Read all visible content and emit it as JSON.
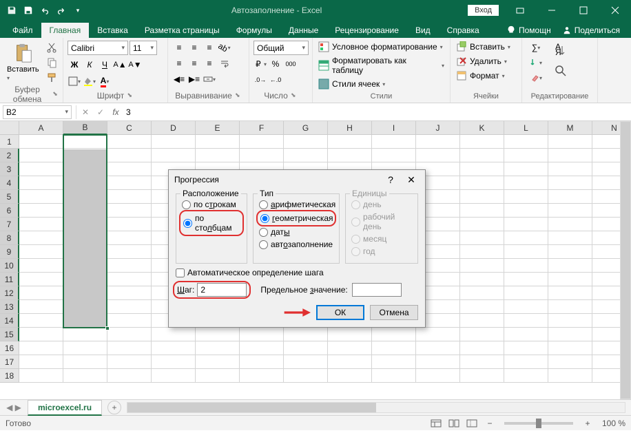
{
  "titlebar": {
    "title": "Автозаполнение  -  Excel",
    "login": "Вход"
  },
  "tabs": {
    "file": "Файл",
    "home": "Главная",
    "insert": "Вставка",
    "layout": "Разметка страницы",
    "formulas": "Формулы",
    "data": "Данные",
    "review": "Рецензирование",
    "view": "Вид",
    "help": "Справка",
    "assist": "Помощн",
    "share": "Поделиться"
  },
  "ribbon": {
    "clipboard": {
      "paste": "Вставить",
      "label": "Буфер обмена"
    },
    "font": {
      "family": "Calibri",
      "size": "11",
      "label": "Шрифт"
    },
    "align": {
      "label": "Выравнивание"
    },
    "number": {
      "format": "Общий",
      "label": "Число"
    },
    "styles": {
      "cond": "Условное форматирование",
      "table": "Форматировать как таблицу",
      "cell": "Стили ячеек",
      "label": "Стили"
    },
    "cells": {
      "insert": "Вставить",
      "delete": "Удалить",
      "format": "Формат",
      "label": "Ячейки"
    },
    "editing": {
      "label": "Редактирование"
    }
  },
  "namebox": "B2",
  "formula": "3",
  "columns": [
    "A",
    "B",
    "C",
    "D",
    "E",
    "F",
    "G",
    "H",
    "I",
    "J",
    "K",
    "L",
    "M",
    "N"
  ],
  "rows": [
    "1",
    "2",
    "3",
    "4",
    "5",
    "6",
    "7",
    "8",
    "9",
    "10",
    "11",
    "12",
    "13",
    "14",
    "15",
    "16",
    "17",
    "18"
  ],
  "cell_b2": "3",
  "sheet": "microexcel.ru",
  "status": {
    "ready": "Готово",
    "zoom": "100 %"
  },
  "dialog": {
    "title": "Прогрессия",
    "layout_label": "Расположение",
    "type_label": "Тип",
    "units_label": "Единицы",
    "by_rows": "по строкам",
    "by_cols": "по столбцам",
    "arith": "арифметическая",
    "geom": "геометрическая",
    "dates": "даты",
    "autofill": "автозаполнение",
    "day": "день",
    "workday": "рабочий день",
    "month": "месяц",
    "year": "год",
    "auto_step": "Автоматическое определение шага",
    "step_label": "Шаг:",
    "step_value": "2",
    "limit_label": "Предельное значение:",
    "limit_value": "",
    "ok": "ОК",
    "cancel": "Отмена"
  }
}
